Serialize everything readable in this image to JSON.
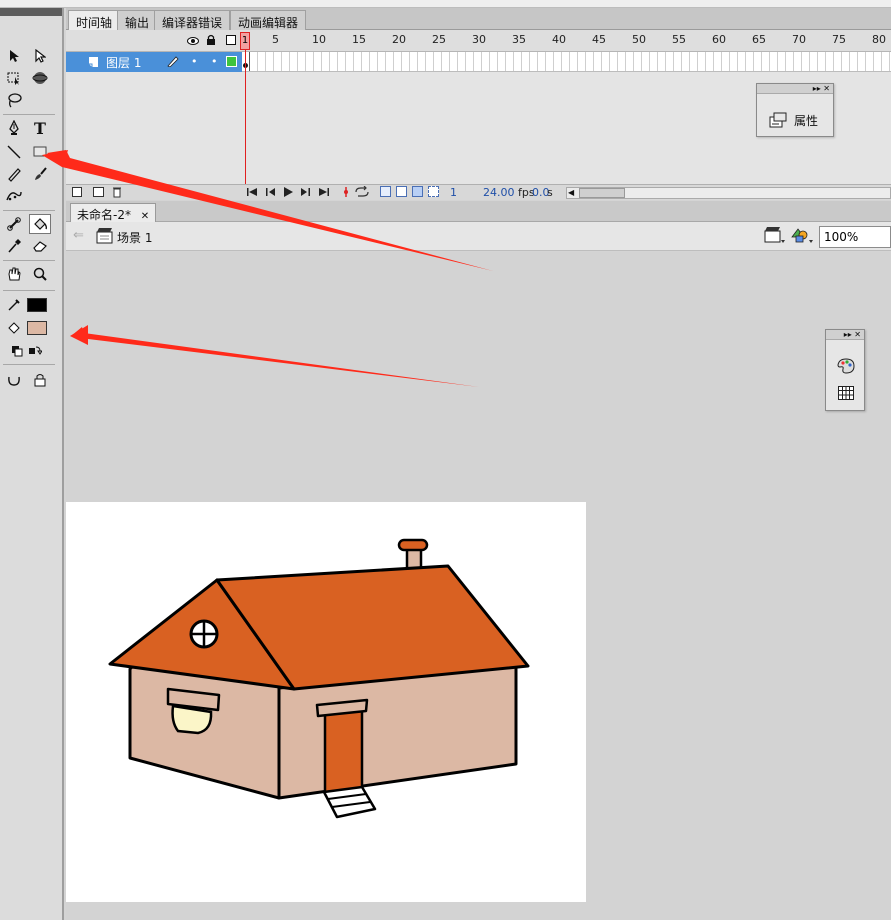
{
  "toolbar": {
    "tools": [
      "selection-tool",
      "subselection-tool",
      "free-transform-tool",
      "3d-rotation-tool",
      "lasso-tool",
      "pen-tool",
      "text-tool",
      "line-tool",
      "rectangle-tool",
      "pencil-tool",
      "brush-tool",
      "deco-tool",
      "bone-tool",
      "paint-bucket-tool",
      "eyedropper-tool",
      "eraser-tool",
      "hand-tool",
      "zoom-tool"
    ],
    "text_tool_glyph": "T",
    "stroke_color": "#000000",
    "fill_color": "#dcb8a4"
  },
  "panel_tabs": [
    "时间轴",
    "输出",
    "编译器错误",
    "动画编辑器"
  ],
  "timeline": {
    "ruler": [
      "1",
      "5",
      "10",
      "15",
      "20",
      "25",
      "30",
      "35",
      "40",
      "45",
      "50",
      "55",
      "60",
      "65",
      "70",
      "75",
      "80"
    ],
    "layer_name": "图层 1",
    "current_frame": "1",
    "fps": "24.00",
    "fps_unit": "fps",
    "time": "0.0",
    "time_unit": "s"
  },
  "properties_panel": {
    "label": "属性"
  },
  "document": {
    "tab": "未命名-2*",
    "scene": "场景 1",
    "zoom": "100%"
  },
  "colors": {
    "roof": "#d96122",
    "wall": "#dcb8a4",
    "door": "#d96122",
    "window": "#fbf5c8",
    "annotation_arrow": "#ff2a1a"
  }
}
